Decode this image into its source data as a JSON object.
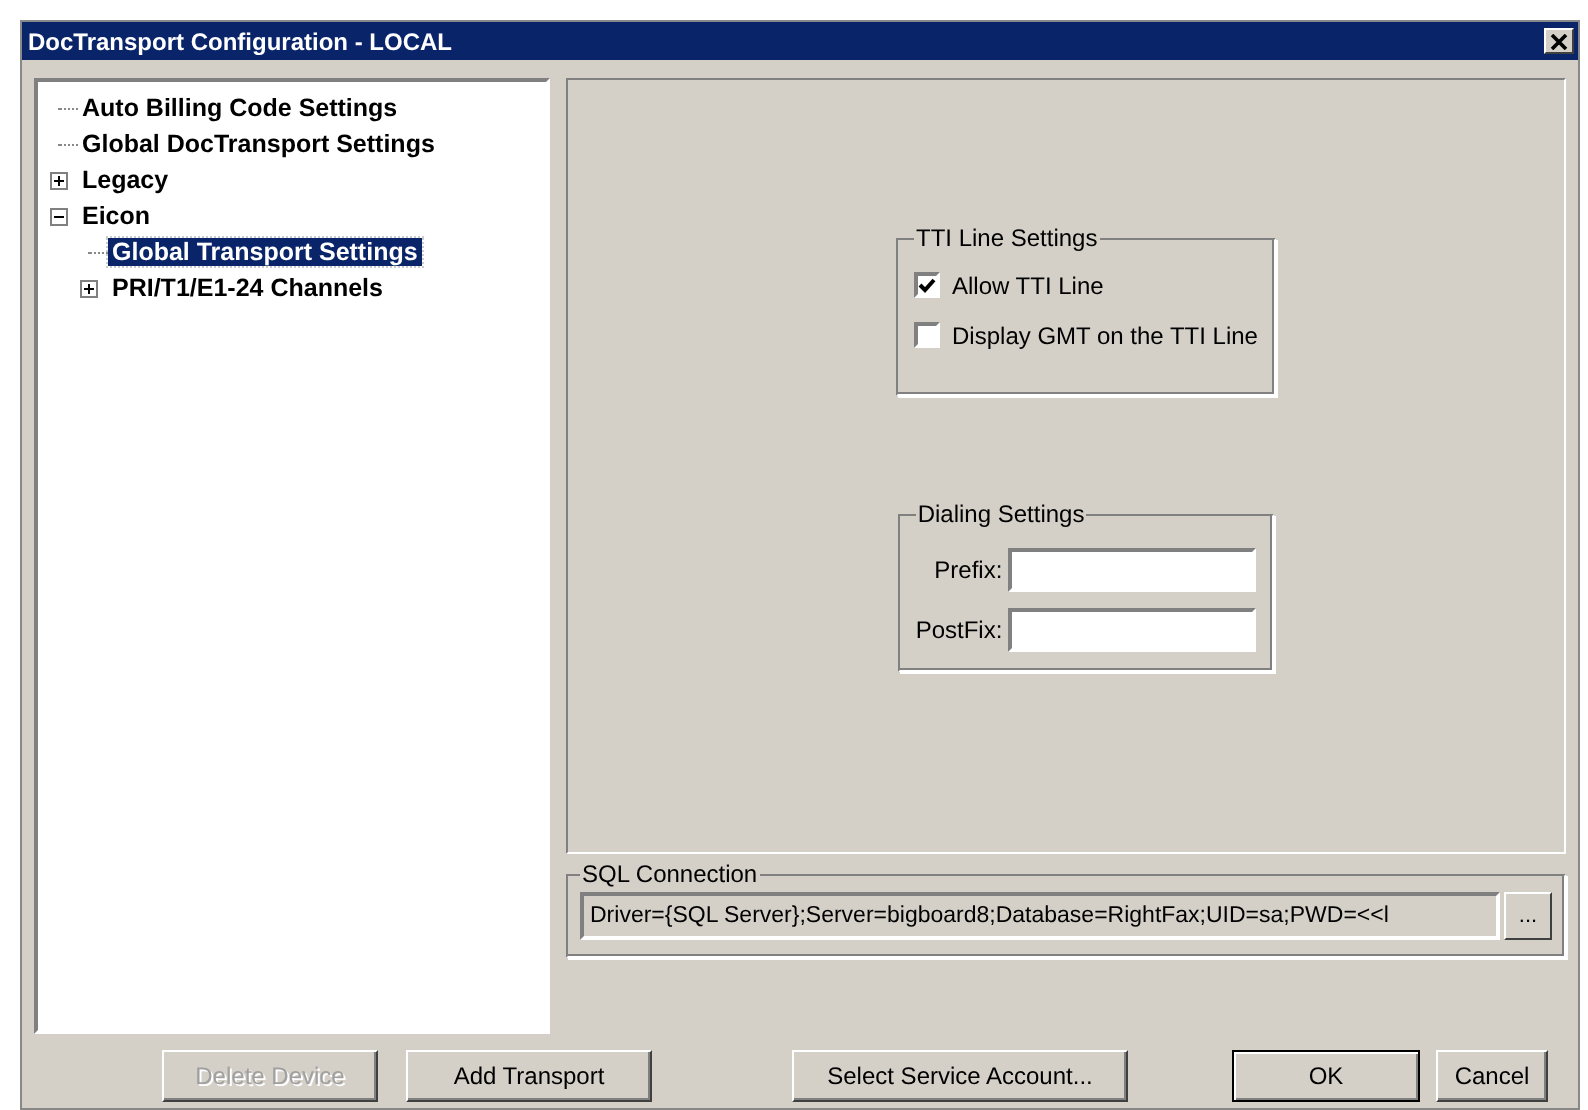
{
  "window": {
    "title": "DocTransport Configuration - LOCAL"
  },
  "tree": [
    {
      "label": "Auto Billing Code Settings",
      "selected": false
    },
    {
      "label": "Global DocTransport Settings",
      "selected": false
    },
    {
      "label": "Legacy",
      "selected": false,
      "expanded": false
    },
    {
      "label": "Eicon",
      "selected": false,
      "expanded": true,
      "children": [
        {
          "label": "Global Transport Settings",
          "selected": true
        },
        {
          "label": "PRI/T1/E1-24 Channels",
          "selected": false,
          "expanded": false
        }
      ]
    }
  ],
  "tti_group": {
    "title": "TTI Line Settings",
    "options": [
      {
        "label": "Allow TTI Line",
        "checked": true
      },
      {
        "label": "Display GMT on the TTI Line",
        "checked": false
      }
    ]
  },
  "dialing_group": {
    "title": "Dialing Settings",
    "fields": [
      {
        "label": "Prefix:"
      },
      {
        "label": "PostFix:"
      }
    ]
  },
  "sql_group": {
    "title": "SQL Connection",
    "value": "Driver={SQL Server};Server=bigboard8;Database=RightFax;UID=sa;PWD=<<l",
    "browse": "..."
  },
  "buttons": [
    {
      "label": "Delete Device",
      "disabled": true,
      "kind": "left"
    },
    {
      "label": "Add Transport",
      "disabled": false,
      "kind": "left"
    },
    {
      "label": "Select Service Account...",
      "disabled": false,
      "kind": "middle"
    },
    {
      "label": "OK",
      "disabled": false,
      "kind": "right"
    },
    {
      "label": "Cancel",
      "disabled": false,
      "kind": "right"
    }
  ]
}
